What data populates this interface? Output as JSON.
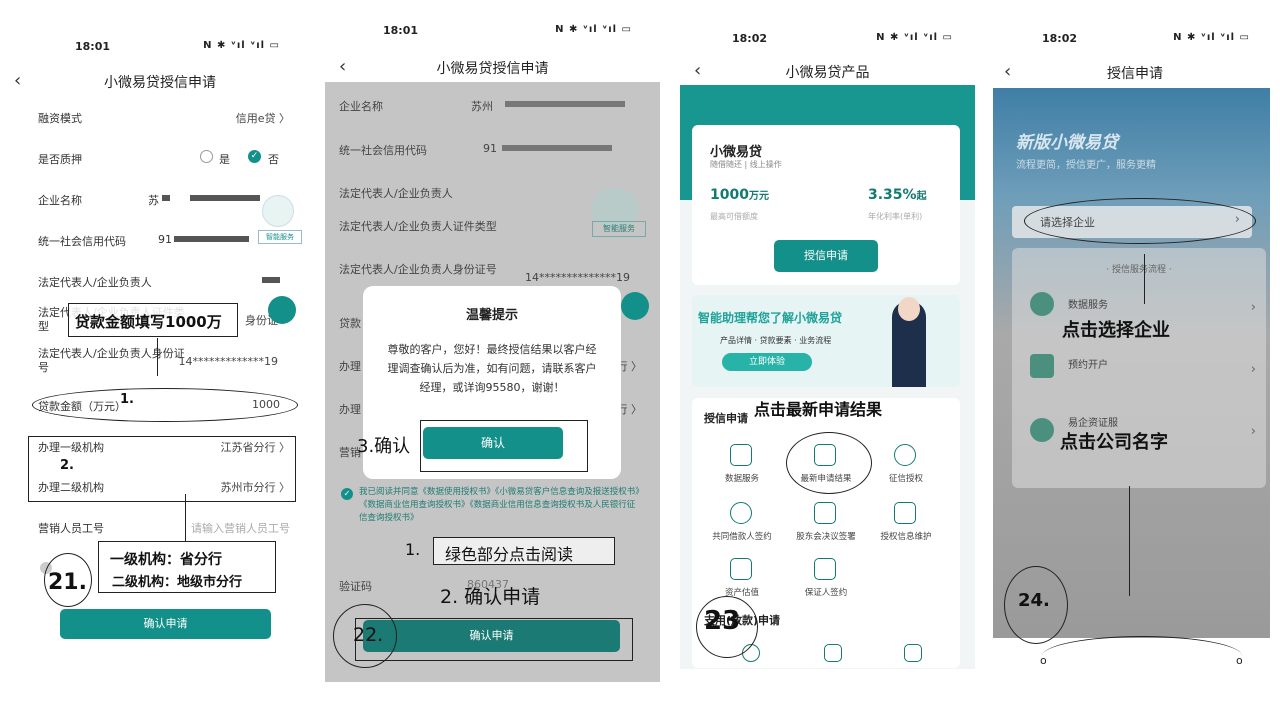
{
  "screens": {
    "s1": {
      "time": "18:01",
      "signal": "N ✱ ᵛıl ᵛıl ▭",
      "title": "小微易贷授信申请",
      "rows": [
        {
          "label": "融资模式",
          "value": "信用e贷 〉"
        },
        {
          "label": "是否质押",
          "opt_yes": "是",
          "opt_no": "否"
        },
        {
          "label": "企业名称",
          "value": "苏"
        },
        {
          "label": "统一社会信用代码",
          "value": "91"
        },
        {
          "label": "法定代表人/企业负责人",
          "value": ""
        },
        {
          "label": "法定代表人/企业负责人证件类型",
          "value": "身份证"
        },
        {
          "label": "法定代表人/企业负责人身份证号",
          "value": "14*************19"
        },
        {
          "label": "贷款金额（万元）",
          "value": "1000"
        },
        {
          "label": "办理一级机构",
          "value": "江苏省分行 〉"
        },
        {
          "label": "办理二级机构",
          "value": "苏州市分行 〉"
        },
        {
          "label": "营销人员工号",
          "value": "请输入营销人员工号"
        }
      ],
      "service_badge": "智能服务",
      "button": "确认申请",
      "annotations": {
        "loan_amount": "贷款金额填写1000万",
        "n1": "1.",
        "n2": "2.",
        "org_line1": "一级机构：省分行",
        "org_line2": "二级机构：地级市分行",
        "step": "21."
      }
    },
    "s2": {
      "time": "18:01",
      "signal": "N ✱ ᵛıl ᵛıl ▭",
      "title": "小微易贷授信申请",
      "rows": [
        {
          "label": "企业名称",
          "value": "苏州"
        },
        {
          "label": "统一社会信用代码",
          "value": "91"
        },
        {
          "label": "法定代表人/企业负责人",
          "value": ""
        },
        {
          "label": "法定代表人/企业负责人证件类型",
          "value": ""
        },
        {
          "label": "法定代表人/企业负责人身份证号",
          "value": "14**************19"
        },
        {
          "label": "贷款",
          "value": ""
        },
        {
          "label": "办理",
          "value": "行 〉"
        },
        {
          "label": "办理",
          "value": "行 〉"
        },
        {
          "label": "营销",
          "value": ""
        }
      ],
      "service_badge": "智能服务",
      "modal": {
        "title": "温馨提示",
        "body": "尊敬的客户，您好！最终授信结果以客户经理调查确认后为准，如有问题，请联系客户经理，或详询95580，谢谢！",
        "button": "确认"
      },
      "agree_text": "我已阅读并同意《数据使用授权书》《小微易贷客户信息查询及报送授权书》《数据商业信用查询授权书》《数据商业信用信息查询授权书及人民银行征信查询授权书》",
      "captcha_label": "验证码",
      "captcha_value": "860437",
      "button": "确认申请",
      "annotations": {
        "confirm": "3.确认",
        "step1": "1.",
        "read": "绿色部分点击阅读",
        "apply": "2. 确认申请",
        "step": "22."
      }
    },
    "s3": {
      "time": "18:02",
      "signal": "N ✱ ᵛıl ᵛıl ▭",
      "title": "小微易贷产品",
      "product": {
        "name": "小微易贷",
        "sub": "随借随还 | 线上操作",
        "amount": "1000",
        "amount_unit": "万元",
        "amount_label": "最高可借额度",
        "rate": "3.35%",
        "rate_suffix": "起",
        "rate_label": "年化利率(单利)",
        "button": "授信申请"
      },
      "banner": {
        "title": "智能助理帮您了解小微易贷",
        "items": "产品详情 · 贷款要素 · 业务流程",
        "button": "立即体验"
      },
      "section_title": "授信申请",
      "grid": [
        {
          "label": "数据服务"
        },
        {
          "label": "最新申请结果"
        },
        {
          "label": "征信授权"
        },
        {
          "label": "共同借款人签约"
        },
        {
          "label": "股东会决议签署"
        },
        {
          "label": "授权信息维护"
        },
        {
          "label": "资产估值"
        },
        {
          "label": "保证人签约"
        }
      ],
      "section2": "支用(放款)申请",
      "annotations": {
        "click": "点击最新申请结果",
        "step": "23"
      }
    },
    "s4": {
      "time": "18:02",
      "signal": "N ✱ ᵛıl ᵛıl ▭",
      "title": "授信申请",
      "banner_title": "新版小微易贷",
      "banner_sub": "流程更简，授信更广，服务更精",
      "select_text": "请选择企业",
      "section": "· 授信服务流程 ·",
      "services": [
        {
          "label": "数据服务"
        },
        {
          "label": "预约开户"
        },
        {
          "label": "易企资证服"
        }
      ],
      "annotations": {
        "select": "点击选择企业",
        "company": "点击公司名字",
        "step": "24."
      }
    }
  }
}
